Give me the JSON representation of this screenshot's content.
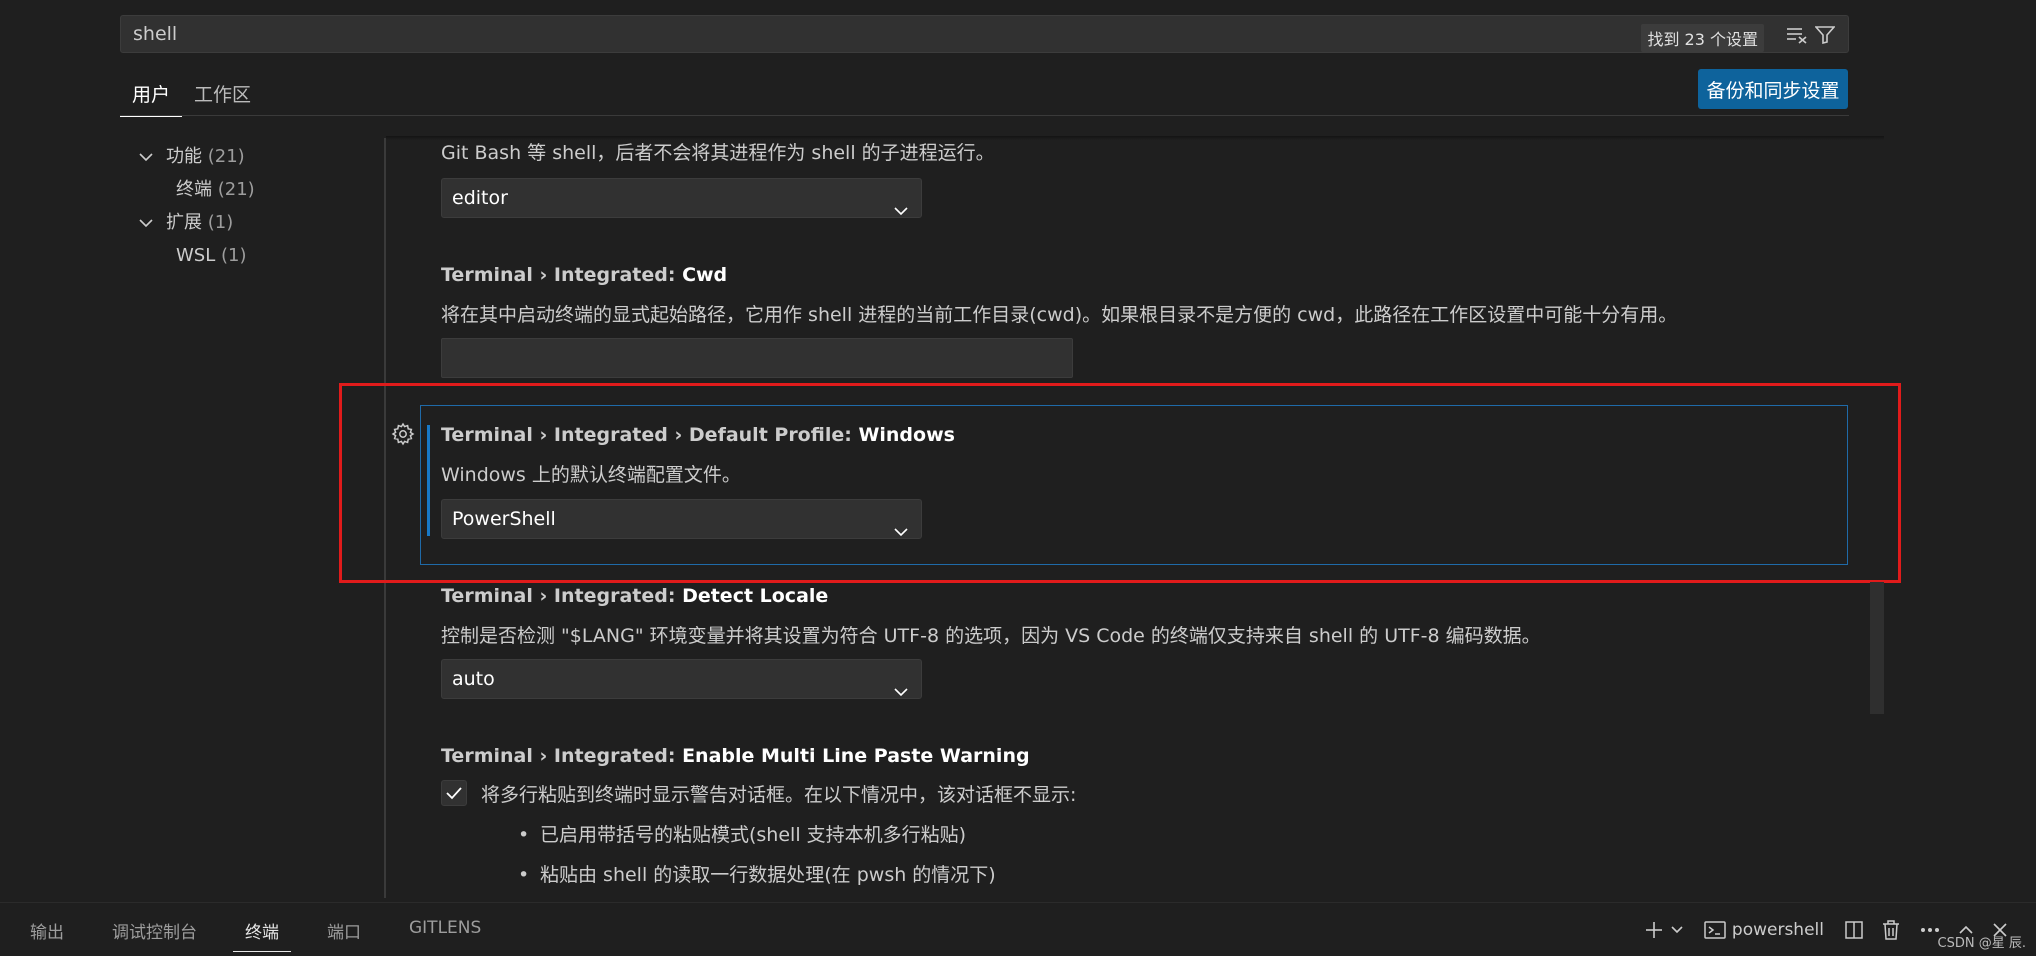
{
  "search": {
    "value": "shell",
    "result_count": "找到 23 个设置"
  },
  "tabs": [
    "用户",
    "工作区"
  ],
  "sync_button": "备份和同步设置",
  "toc": [
    {
      "label": "功能",
      "count": "(21)",
      "level": 0,
      "expanded": true
    },
    {
      "label": "终端",
      "count": "(21)",
      "level": 1
    },
    {
      "label": "扩展",
      "count": "(1)",
      "level": 0,
      "expanded": true
    },
    {
      "label": "WSL",
      "count": "(1)",
      "level": 1
    }
  ],
  "settings": {
    "prev_desc": "Git Bash 等 shell，后者不会将其进程作为 shell 的子进程运行。",
    "prev_value": "editor",
    "cwd": {
      "category": "Terminal › Integrated: ",
      "name": "Cwd",
      "desc": "将在其中启动终端的显式起始路径，它用作 shell 进程的当前工作目录(cwd)。如果根目录不是方便的 cwd，此路径在工作区设置中可能十分有用。"
    },
    "default_profile": {
      "category": "Terminal › Integrated › Default Profile: ",
      "name": "Windows",
      "desc": "Windows 上的默认终端配置文件。",
      "value": "PowerShell"
    },
    "detect_locale": {
      "category": "Terminal › Integrated: ",
      "name": "Detect Locale",
      "desc": "控制是否检测 \"$LANG\" 环境变量并将其设置为符合 UTF-8 的选项，因为 VS Code 的终端仅支持来自 shell 的 UTF-8 编码数据。",
      "value": "auto"
    },
    "multi_line_paste": {
      "category": "Terminal › Integrated: ",
      "name": "Enable Multi Line Paste Warning",
      "desc": "将多行粘贴到终端时显示警告对话框。在以下情况中，该对话框不显示:",
      "checked": true,
      "bullets": [
        "已启用带括号的粘贴模式(shell 支持本机多行粘贴)",
        "粘贴由 shell 的读取一行数据处理(在 pwsh 的情况下)"
      ]
    }
  },
  "panel": {
    "tabs": [
      "输出",
      "调试控制台",
      "终端",
      "端口",
      "GITLENS"
    ],
    "active_tab": "终端",
    "terminal_name": "powershell"
  },
  "watermark": "CSDN @星 辰.",
  "colors": {
    "accent": "#0e639c",
    "focus_border": "#1f6aa8",
    "annotation_red": "#e01b1b"
  }
}
